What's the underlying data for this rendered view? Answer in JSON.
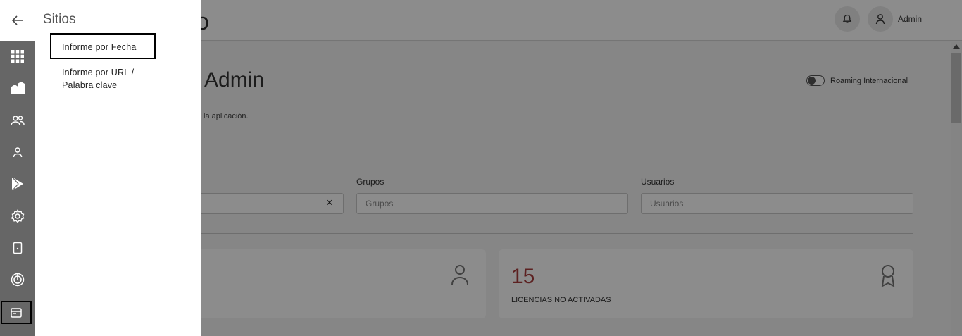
{
  "header": {
    "logo_fragment": "o",
    "user_name": "Admin"
  },
  "dashboard": {
    "welcome": "s, Admin",
    "welcome_subtitle": "la aplicación.",
    "roaming_label": "Roaming Internacional",
    "roaming_enabled": false,
    "filters": [
      {
        "label": "",
        "placeholder": ""
      },
      {
        "label": "Grupos",
        "placeholder": "Grupos"
      },
      {
        "label": "Usuarios",
        "placeholder": "Usuarios"
      }
    ],
    "clear_icon": "×",
    "cards": [
      {
        "number": "",
        "label": "",
        "icon": "user-icon"
      },
      {
        "number": "15",
        "label": "LICENCIAS NO ACTIVADAS",
        "icon": "award-icon",
        "number_color": "#a83d3d"
      }
    ]
  },
  "rail": {
    "items": [
      {
        "name": "back-arrow-icon"
      },
      {
        "name": "apps-grid-icon"
      },
      {
        "name": "buildings-icon"
      },
      {
        "name": "users-icon"
      },
      {
        "name": "user-icon"
      },
      {
        "name": "play-store-icon"
      },
      {
        "name": "settings-icon"
      },
      {
        "name": "device-icon"
      },
      {
        "name": "tracking-icon"
      },
      {
        "name": "browser-window-icon",
        "selected": true
      }
    ]
  },
  "flyout": {
    "title": "Sitios",
    "links": [
      {
        "label": "Informe por Fecha",
        "highlighted": true
      },
      {
        "label": "Informe por URL / Palabra clave"
      }
    ]
  },
  "colors": {
    "rail_background": "#666666",
    "overlay": "rgba(0,0,0,0.45)",
    "accent_number": "#a83d3d"
  }
}
